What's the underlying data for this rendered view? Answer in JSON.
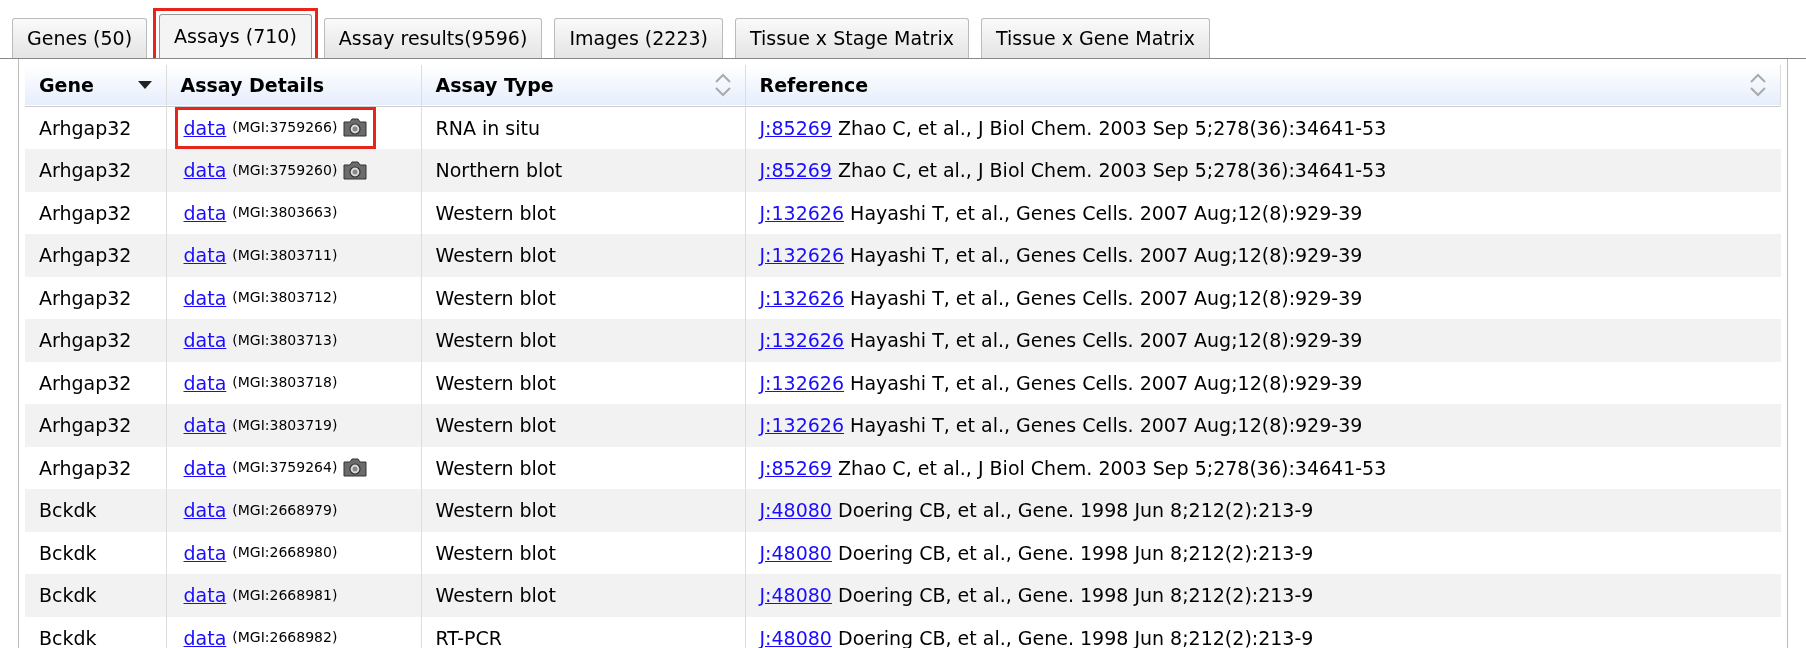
{
  "tabs": [
    {
      "label": "Genes (50)",
      "selected": false,
      "highlighted": false
    },
    {
      "label": "Assays (710)",
      "selected": true,
      "highlighted": true
    },
    {
      "label": "Assay results(9596)",
      "selected": false,
      "highlighted": false
    },
    {
      "label": "Images (2223)",
      "selected": false,
      "highlighted": false
    },
    {
      "label": "Tissue x Stage Matrix",
      "selected": false,
      "highlighted": false
    },
    {
      "label": "Tissue x Gene Matrix",
      "selected": false,
      "highlighted": false
    }
  ],
  "table": {
    "columns": [
      {
        "label": "Gene",
        "sorted": true
      },
      {
        "label": "Assay Details",
        "sorted": false,
        "sortable": false
      },
      {
        "label": "Assay Type",
        "sorted": false,
        "sortable": true
      },
      {
        "label": "Reference",
        "sorted": false,
        "sortable": true
      }
    ],
    "rows": [
      {
        "gene": "Arhgap32",
        "link": "data",
        "mgi": "(MGI:3759266)",
        "has_image": true,
        "highlighted": true,
        "assay_type": "RNA in situ",
        "ref_link": "J:85269",
        "citation": "Zhao C, et al., J Biol Chem. 2003 Sep 5;278(36):34641-53"
      },
      {
        "gene": "Arhgap32",
        "link": "data",
        "mgi": "(MGI:3759260)",
        "has_image": true,
        "highlighted": false,
        "assay_type": "Northern blot",
        "ref_link": "J:85269",
        "citation": "Zhao C, et al., J Biol Chem. 2003 Sep 5;278(36):34641-53"
      },
      {
        "gene": "Arhgap32",
        "link": "data",
        "mgi": "(MGI:3803663)",
        "has_image": false,
        "highlighted": false,
        "assay_type": "Western blot",
        "ref_link": "J:132626",
        "citation": "Hayashi T, et al., Genes Cells. 2007 Aug;12(8):929-39"
      },
      {
        "gene": "Arhgap32",
        "link": "data",
        "mgi": "(MGI:3803711)",
        "has_image": false,
        "highlighted": false,
        "assay_type": "Western blot",
        "ref_link": "J:132626",
        "citation": "Hayashi T, et al., Genes Cells. 2007 Aug;12(8):929-39"
      },
      {
        "gene": "Arhgap32",
        "link": "data",
        "mgi": "(MGI:3803712)",
        "has_image": false,
        "highlighted": false,
        "assay_type": "Western blot",
        "ref_link": "J:132626",
        "citation": "Hayashi T, et al., Genes Cells. 2007 Aug;12(8):929-39"
      },
      {
        "gene": "Arhgap32",
        "link": "data",
        "mgi": "(MGI:3803713)",
        "has_image": false,
        "highlighted": false,
        "assay_type": "Western blot",
        "ref_link": "J:132626",
        "citation": "Hayashi T, et al., Genes Cells. 2007 Aug;12(8):929-39"
      },
      {
        "gene": "Arhgap32",
        "link": "data",
        "mgi": "(MGI:3803718)",
        "has_image": false,
        "highlighted": false,
        "assay_type": "Western blot",
        "ref_link": "J:132626",
        "citation": "Hayashi T, et al., Genes Cells. 2007 Aug;12(8):929-39"
      },
      {
        "gene": "Arhgap32",
        "link": "data",
        "mgi": "(MGI:3803719)",
        "has_image": false,
        "highlighted": false,
        "assay_type": "Western blot",
        "ref_link": "J:132626",
        "citation": "Hayashi T, et al., Genes Cells. 2007 Aug;12(8):929-39"
      },
      {
        "gene": "Arhgap32",
        "link": "data",
        "mgi": "(MGI:3759264)",
        "has_image": true,
        "highlighted": false,
        "assay_type": "Western blot",
        "ref_link": "J:85269",
        "citation": "Zhao C, et al., J Biol Chem. 2003 Sep 5;278(36):34641-53"
      },
      {
        "gene": "Bckdk",
        "link": "data",
        "mgi": "(MGI:2668979)",
        "has_image": false,
        "highlighted": false,
        "assay_type": "Western blot",
        "ref_link": "J:48080",
        "citation": "Doering CB, et al., Gene. 1998 Jun 8;212(2):213-9"
      },
      {
        "gene": "Bckdk",
        "link": "data",
        "mgi": "(MGI:2668980)",
        "has_image": false,
        "highlighted": false,
        "assay_type": "Western blot",
        "ref_link": "J:48080",
        "citation": "Doering CB, et al., Gene. 1998 Jun 8;212(2):213-9"
      },
      {
        "gene": "Bckdk",
        "link": "data",
        "mgi": "(MGI:2668981)",
        "has_image": false,
        "highlighted": false,
        "assay_type": "Western blot",
        "ref_link": "J:48080",
        "citation": "Doering CB, et al., Gene. 1998 Jun 8;212(2):213-9"
      },
      {
        "gene": "Bckdk",
        "link": "data",
        "mgi": "(MGI:2668982)",
        "has_image": false,
        "highlighted": false,
        "assay_type": "RT-PCR",
        "ref_link": "J:48080",
        "citation": "Doering CB, et al., Gene. 1998 Jun 8;212(2):213-9"
      }
    ]
  }
}
